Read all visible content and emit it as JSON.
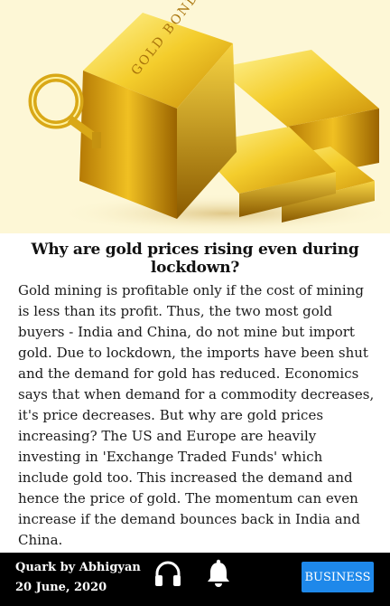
{
  "hero": {
    "image_name": "gold-bars-image",
    "engraving": "GOLD BONDS",
    "colors": {
      "background": "#fdf7d6",
      "gold_light": "#ffe866",
      "gold_mid": "#e0b219",
      "gold_dark": "#8a5a00"
    }
  },
  "article": {
    "headline": "Why are gold prices rising even during lockdown?",
    "body": "Gold mining is profitable only if the cost of mining is less than its profit. Thus, the two most gold buyers - India and China, do not mine but import gold. Due to lockdown, the imports have been shut and the demand for gold has reduced. Economics says that when demand for a commodity decreases, it's price decreases. But why are gold prices increasing? The US and Europe are heavily investing in 'Exchange Traded Funds' which include gold too. This increased the demand and hence the price of gold. The momentum can even increase if the demand bounces back in India and China."
  },
  "footer": {
    "source": "Quark by Abhigyan",
    "date": "20 June, 2020",
    "category_label": "BUSINESS",
    "icons": [
      "headphones-icon",
      "bell-icon"
    ],
    "colors": {
      "background": "#000000",
      "accent": "#1e88ea"
    }
  }
}
